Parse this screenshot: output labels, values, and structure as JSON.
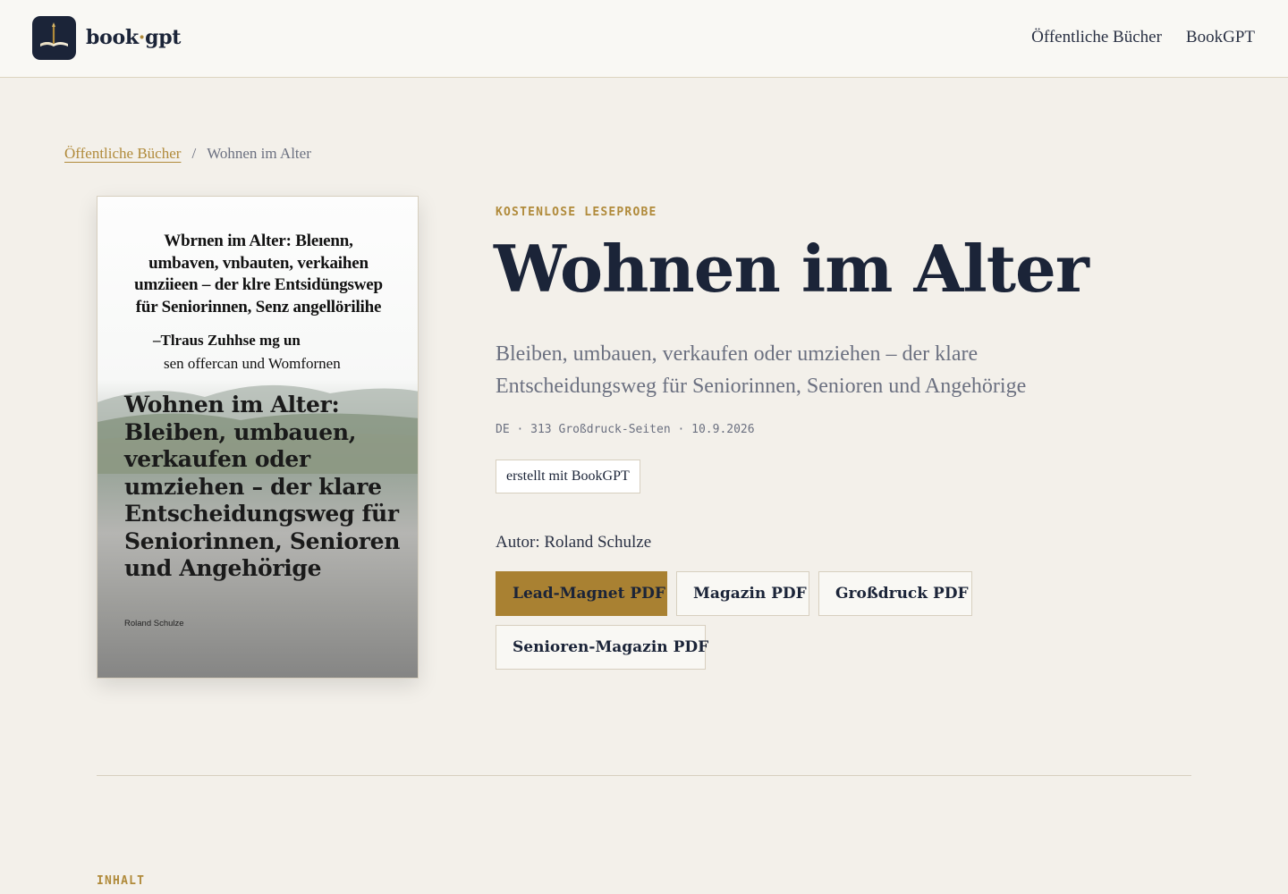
{
  "header": {
    "brand_left": "book",
    "brand_dot": "·",
    "brand_right": "gpt",
    "logo_icon": "open-book-quill-icon",
    "nav": [
      "Öffentliche Bücher",
      "BookGPT"
    ]
  },
  "breadcrumb": {
    "parent": "Öffentliche Bücher",
    "separator": "/",
    "current": "Wohnen im Alter"
  },
  "cover": {
    "garbled_lines": [
      "Wbrnen im Alter: Bleıenn,",
      "umbaven, vnbauten, verkaihen",
      "umziieen – der klre Entsidüngswep",
      "für Seniorinnen, Senz angellörilihe"
    ],
    "garbled_sub": [
      "–Tlraus Zuhhse mg un",
      "sen offercan und Womfornen"
    ],
    "title": "Wohnen im Alter: Bleiben, umbauen, verkaufen oder umziehen – der klare Entscheidungsweg für Seniorinnen, Senioren und Angehörige",
    "author": "Roland Schulze"
  },
  "book": {
    "eyebrow": "KOSTENLOSE LESEPROBE",
    "title": "Wohnen im Alter",
    "subtitle": "Bleiben, umbauen, verkaufen oder umziehen – der klare Entscheidungsweg für Seniorinnen, Senioren und Angehörige",
    "meta": "DE · 313 Großdruck-Seiten · 10.9.2026",
    "badge": "erstellt mit BookGPT",
    "author": "Autor: Roland Schulze"
  },
  "downloads": [
    "Lead-Magnet PDF",
    "Magazin PDF",
    "Großdruck PDF",
    "Senioren-Magazin PDF"
  ],
  "sections": {
    "contents_label": "INHALT"
  },
  "colors": {
    "accent": "#b08a3a",
    "primary_button": "#a98132",
    "ink": "#1b2438",
    "page_bg": "#f3f0ea"
  }
}
